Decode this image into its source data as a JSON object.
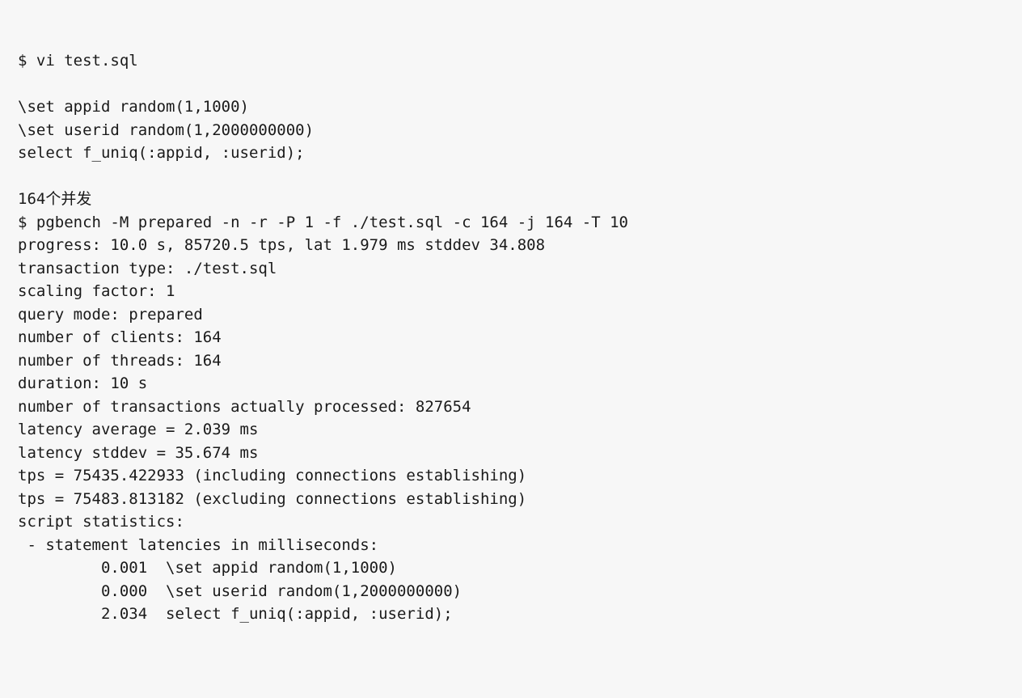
{
  "lines": [
    "$ vi test.sql",
    "",
    "\\set appid random(1,1000)",
    "\\set userid random(1,2000000000)",
    "select f_uniq(:appid, :userid);",
    "",
    "164个并发",
    "$ pgbench -M prepared -n -r -P 1 -f ./test.sql -c 164 -j 164 -T 10",
    "progress: 10.0 s, 85720.5 tps, lat 1.979 ms stddev 34.808",
    "transaction type: ./test.sql",
    "scaling factor: 1",
    "query mode: prepared",
    "number of clients: 164",
    "number of threads: 164",
    "duration: 10 s",
    "number of transactions actually processed: 827654",
    "latency average = 2.039 ms",
    "latency stddev = 35.674 ms",
    "tps = 75435.422933 (including connections establishing)",
    "tps = 75483.813182 (excluding connections establishing)",
    "script statistics:",
    " - statement latencies in milliseconds:",
    "         0.001  \\set appid random(1,1000)",
    "         0.000  \\set userid random(1,2000000000)",
    "         2.034  select f_uniq(:appid, :userid);"
  ]
}
